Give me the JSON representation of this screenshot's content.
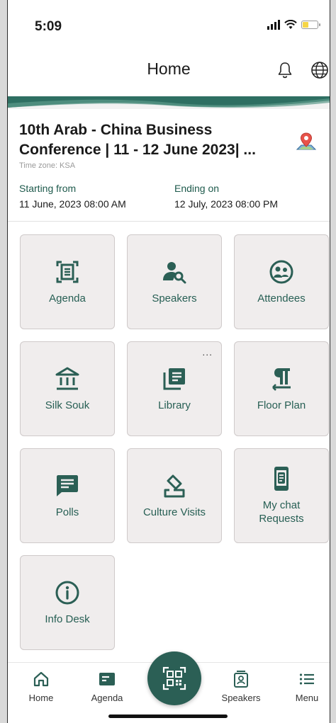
{
  "status_bar": {
    "time": "5:09"
  },
  "header": {
    "title": "Home"
  },
  "event": {
    "title": "10th Arab - China Business Conference | 11 - 12 June 2023| ...",
    "timezone": "Time zone: KSA",
    "start_label": "Starting from",
    "start_value": "11 June, 2023   08:00 AM",
    "end_label": "Ending on",
    "end_value": "12 July, 2023   08:00 PM"
  },
  "tiles": [
    {
      "label": "Agenda",
      "icon": "agenda-icon"
    },
    {
      "label": "Speakers",
      "icon": "speakers-icon"
    },
    {
      "label": "Attendees",
      "icon": "attendees-icon"
    },
    {
      "label": "Silk Souk",
      "icon": "bank-icon"
    },
    {
      "label": "Library",
      "icon": "library-icon",
      "more": "..."
    },
    {
      "label": "Floor Plan",
      "icon": "floor-plan-icon"
    },
    {
      "label": "Polls",
      "icon": "polls-icon"
    },
    {
      "label": "Culture Visits",
      "icon": "culture-visits-icon"
    },
    {
      "label": "My chat Requests",
      "icon": "chat-requests-icon"
    },
    {
      "label": "Info Desk",
      "icon": "info-icon"
    }
  ],
  "bottom_nav": [
    {
      "label": "Home",
      "icon": "home-icon"
    },
    {
      "label": "Agenda",
      "icon": "agenda-card-icon"
    },
    {
      "label": "Speakers",
      "icon": "speakers-badge-icon"
    },
    {
      "label": "Menu",
      "icon": "menu-icon"
    }
  ],
  "colors": {
    "accent": "#2b5f55",
    "tile_bg": "#f0eded",
    "label": "#275f54",
    "location_pin": "#e8534a"
  }
}
